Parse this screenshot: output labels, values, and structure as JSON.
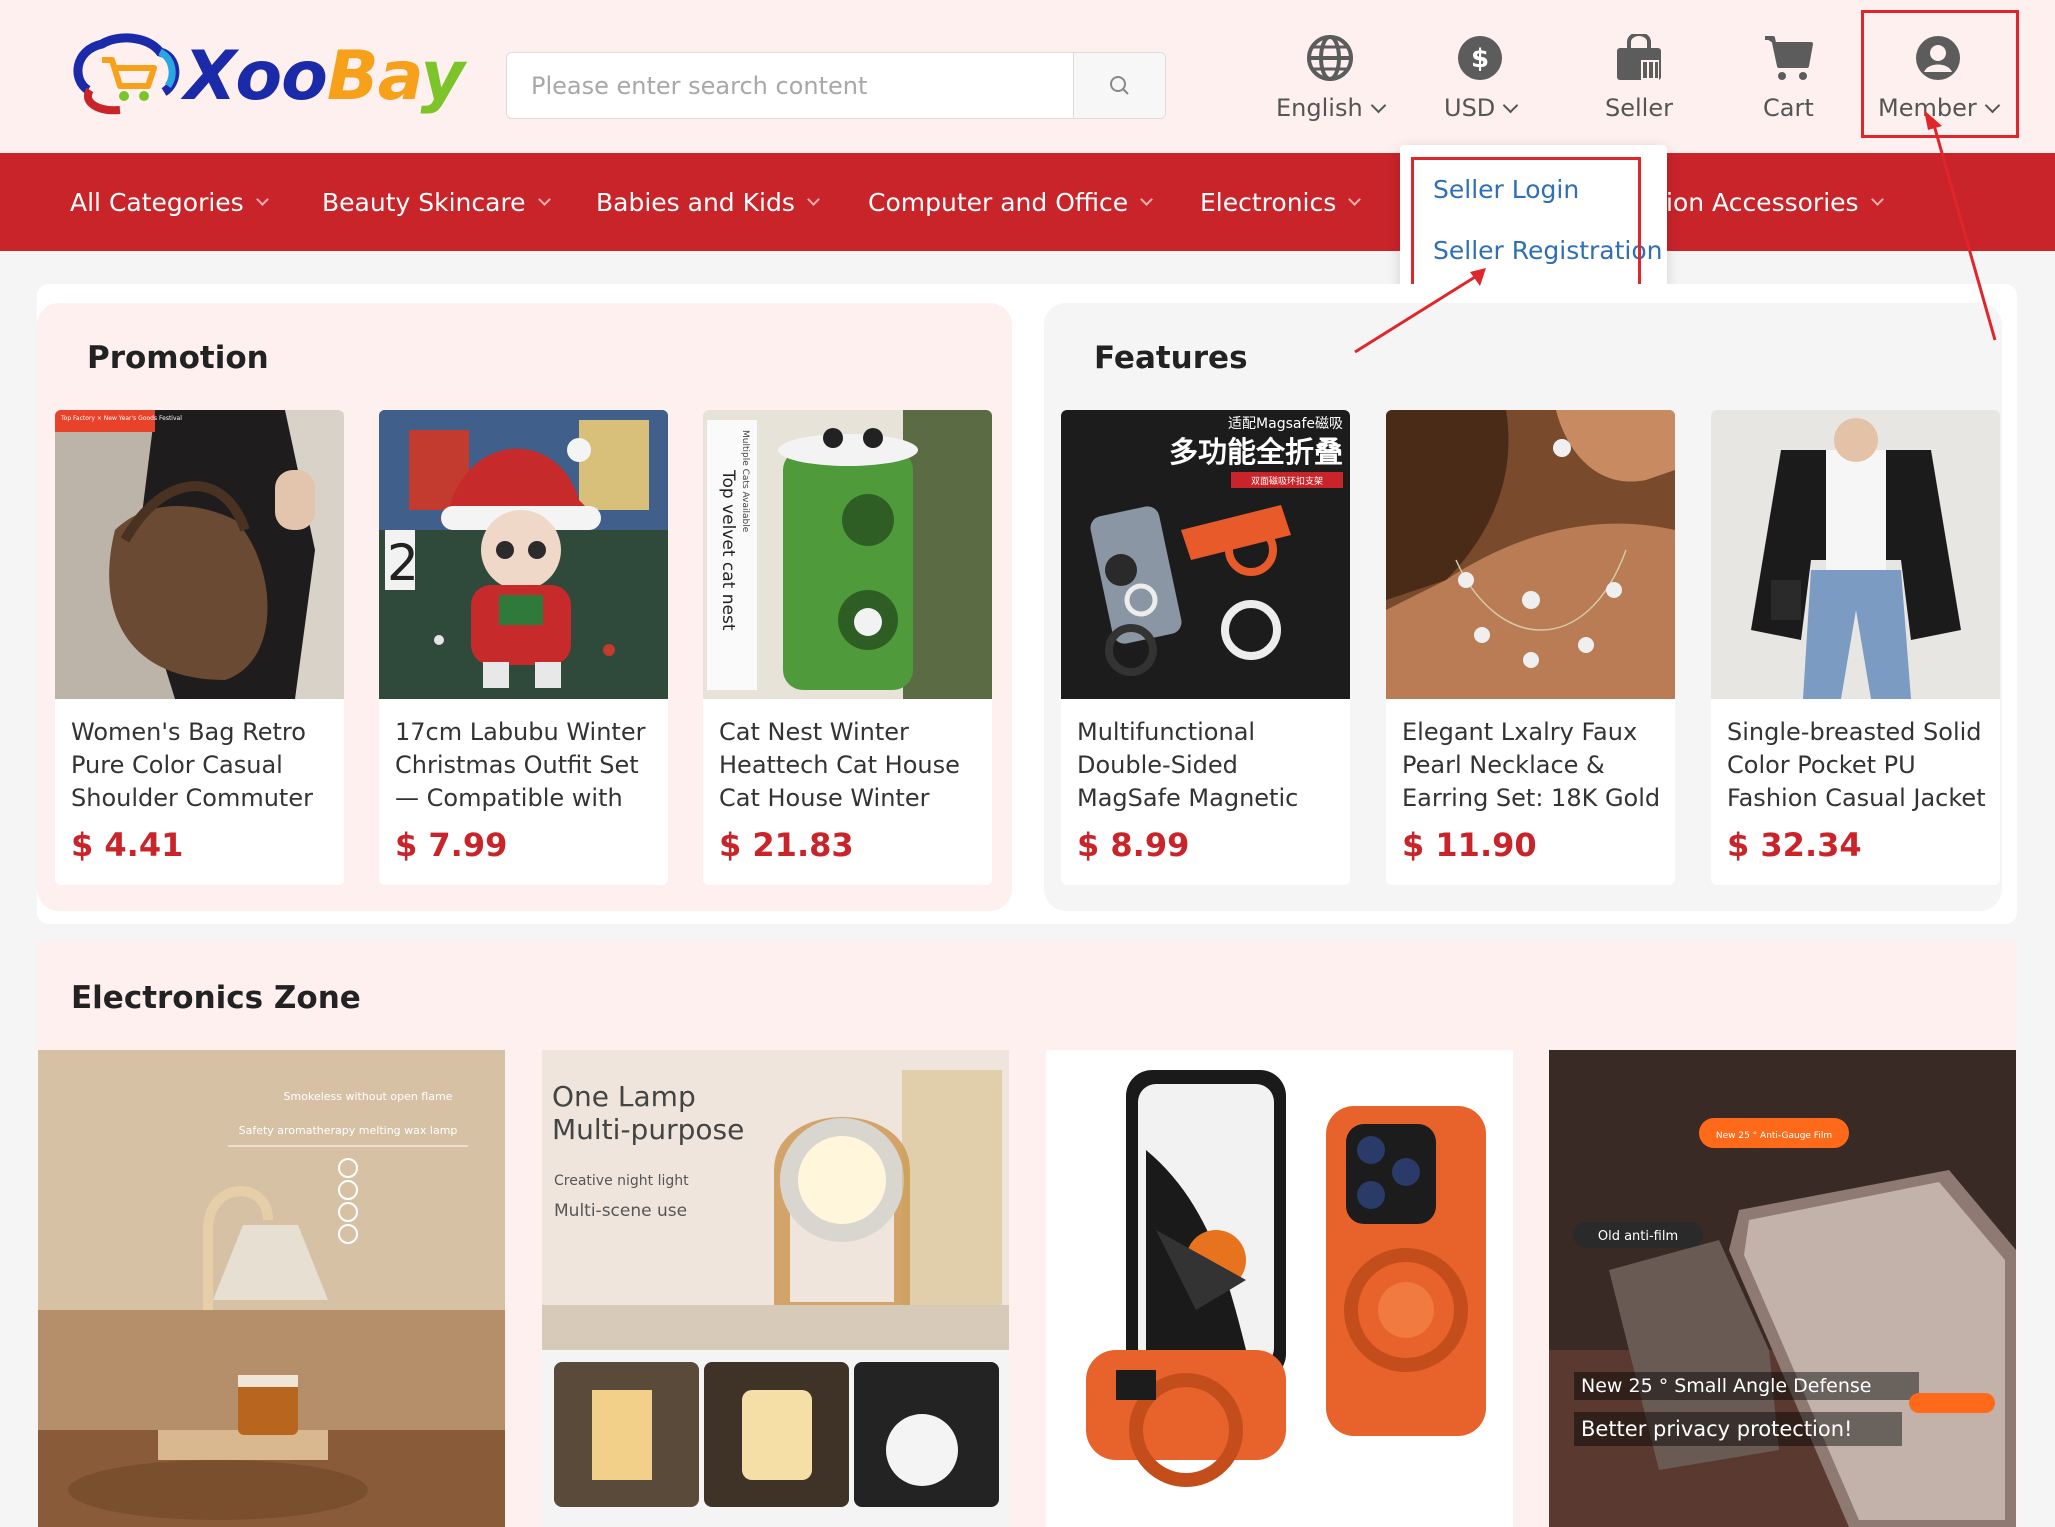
{
  "header": {
    "logo_text": {
      "x": "Xoo",
      "b": "Ba",
      "y": "y"
    },
    "search": {
      "placeholder": "Please enter search content"
    },
    "nav": {
      "language": "English",
      "currency": "USD",
      "seller": "Seller",
      "cart": "Cart",
      "member": "Member"
    }
  },
  "categories": [
    "All Categories",
    "Beauty Skincare",
    "Babies and Kids",
    "Computer and Office",
    "Electronics",
    "Fashion Accessories"
  ],
  "categories_visible": {
    "hidden_suffix": "ion Accessories"
  },
  "seller_dropdown": {
    "items": [
      "Seller Login",
      "Seller Registration"
    ]
  },
  "promotion": {
    "title": "Promotion",
    "products": [
      {
        "name": "Women's Bag Retro Pure Color Casual Shoulder Commuter",
        "price": "$ 4.41",
        "badge": "Top Factory × New Year's Goods Festival"
      },
      {
        "name": "17cm Labubu Winter Christmas Outfit Set — Compatible with",
        "price": "$ 7.99"
      },
      {
        "name": "Cat Nest Winter Heattech Cat House Cat House Winter",
        "price": "$ 21.83",
        "overlay": "Top velvet cat nest",
        "overlay2": "Multiple Cats Available"
      }
    ]
  },
  "features": {
    "title": "Features",
    "products": [
      {
        "name": "Multifunctional Double-Sided MagSafe Magnetic",
        "price": "$ 8.99",
        "overlay_top": "适配Magsafe磁吸",
        "overlay_main": "多功能全折叠",
        "overlay_tag": "双面磁吸环扣支架"
      },
      {
        "name": "Elegant Lxalry Faux Pearl Necklace & Earring Set: 18K Gold",
        "price": "$ 11.90"
      },
      {
        "name": "Single-breasted Solid Color Pocket PU Fashion Casual Jacket",
        "price": "$ 32.34"
      }
    ]
  },
  "electronics": {
    "title": "Electronics Zone",
    "items": [
      {
        "line1": "Smokeless without open flame",
        "line2": "Safety aromatherapy melting wax lamp"
      },
      {
        "line1": "One Lamp",
        "line2": "Multi-purpose",
        "line3": "Creative night light",
        "line4": "Multi-scene use"
      },
      {},
      {
        "tag": "New 25 ° Anti-Gauge Film",
        "old": "Old anti-film",
        "cap1": "New 25 ° Small Angle Defense",
        "cap2": "Better privacy protection!"
      }
    ]
  },
  "colors": {
    "brand_red": "#c8242a",
    "header_bg": "#fdf0ef",
    "link_blue": "#2f6fb6",
    "annotation_red": "#e0262b"
  }
}
